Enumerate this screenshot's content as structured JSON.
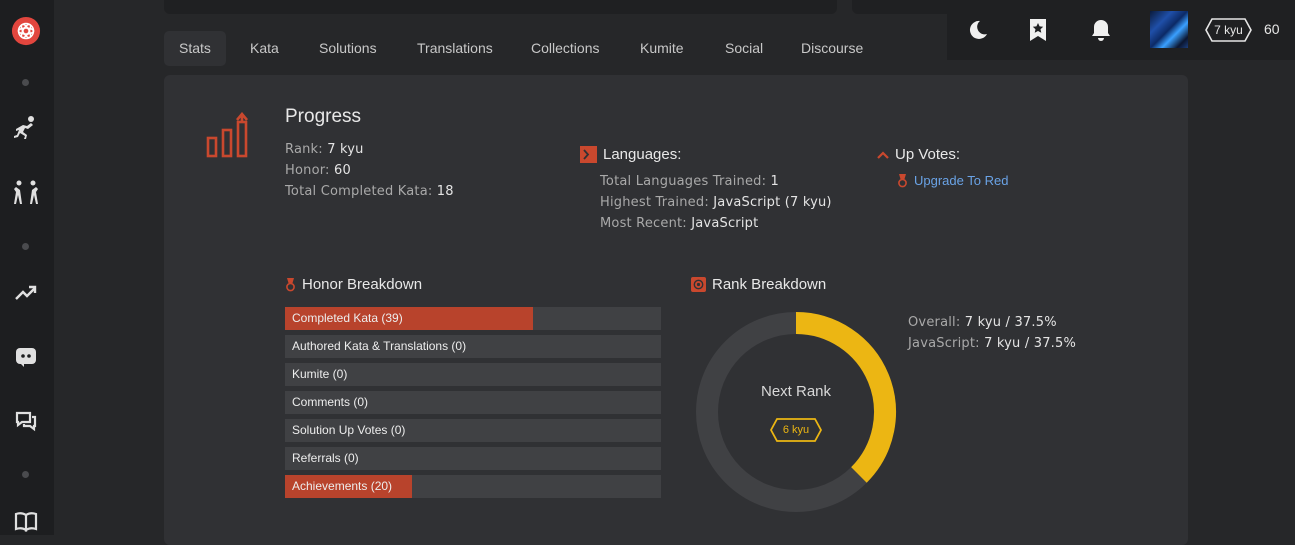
{
  "sidebar": {
    "icons": [
      "codewars-logo-icon",
      "training-icon",
      "practice-icon",
      "leaderboard-icon",
      "discord-icon",
      "discussions-icon",
      "docs-icon"
    ]
  },
  "header": {
    "rank": "7 kyu",
    "honor": "60",
    "icons": [
      "moon-icon",
      "bookmark-icon",
      "bell-icon"
    ]
  },
  "tabs": [
    "Stats",
    "Kata",
    "Solutions",
    "Translations",
    "Collections",
    "Kumite",
    "Social",
    "Discourse"
  ],
  "active_tab": "Stats",
  "progress": {
    "title": "Progress",
    "rank_label": "Rank:",
    "rank_value": "7 kyu",
    "honor_label": "Honor:",
    "honor_value": "60",
    "completed_label": "Total Completed Kata:",
    "completed_value": "18"
  },
  "languages": {
    "title": "Languages:",
    "total_label": "Total Languages Trained:",
    "total_value": "1",
    "highest_label": "Highest Trained:",
    "highest_value": "JavaScript (7 kyu)",
    "recent_label": "Most Recent:",
    "recent_value": "JavaScript"
  },
  "upvotes": {
    "title": "Up Votes:",
    "link": "Upgrade To Red"
  },
  "honor_breakdown": {
    "title": "Honor Breakdown",
    "items": [
      {
        "label": "Completed Kata (39)",
        "fraction": 0.66
      },
      {
        "label": "Authored Kata & Translations (0)",
        "fraction": 0
      },
      {
        "label": "Kumite (0)",
        "fraction": 0
      },
      {
        "label": "Comments (0)",
        "fraction": 0
      },
      {
        "label": "Solution Up Votes (0)",
        "fraction": 0
      },
      {
        "label": "Referrals (0)",
        "fraction": 0
      },
      {
        "label": "Achievements (20)",
        "fraction": 0.338
      }
    ]
  },
  "rank_breakdown": {
    "title": "Rank Breakdown",
    "next_rank_label": "Next Rank",
    "next_rank": "6 kyu",
    "progress_fraction": 0.375,
    "overall_label": "Overall:",
    "overall_value": "7 kyu / 37.5%",
    "js_label": "JavaScript:",
    "js_value": "7 kyu / 37.5%"
  },
  "colors": {
    "accent": "#b8432c",
    "rank_yellow": "#ecb613",
    "link": "#6aa3e6"
  }
}
